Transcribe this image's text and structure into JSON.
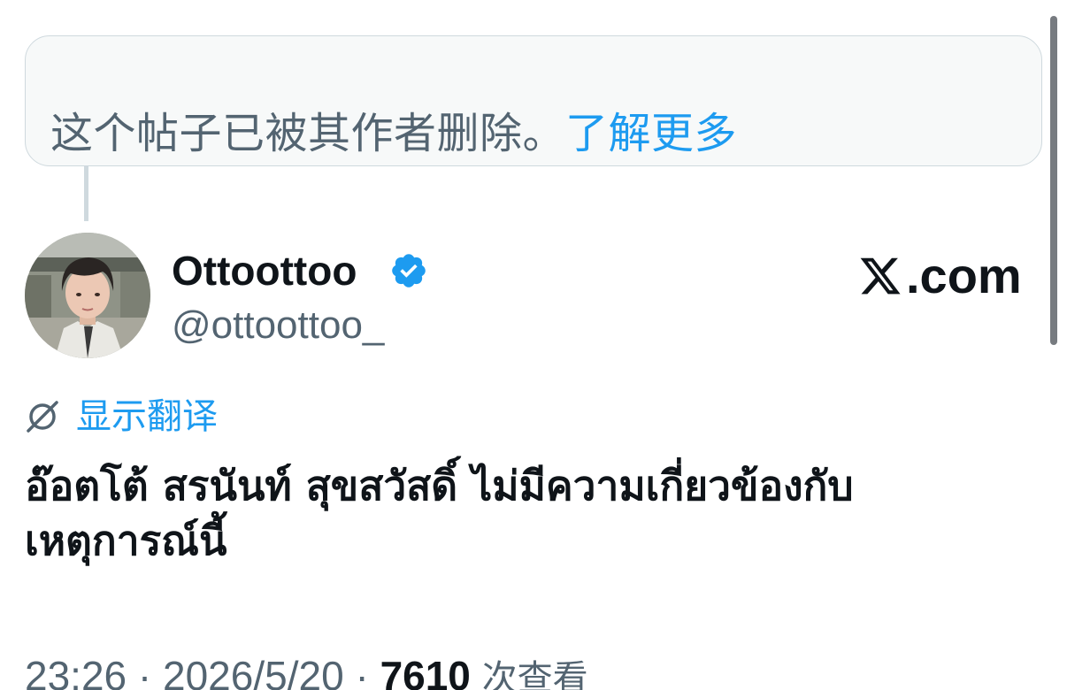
{
  "deleted_notice": {
    "text": "这个帖子已被其作者删除。",
    "link": "了解更多"
  },
  "author": {
    "display_name": "Ottoottoo",
    "handle": "@ottoottoo_",
    "verified": true,
    "avatar": "avatar"
  },
  "source": {
    "label": ".com",
    "logo": "x-logo"
  },
  "translate": {
    "icon": "globe-slash-icon",
    "label": "显示翻译"
  },
  "post": {
    "text": "อ๊อตโต้ สรนันท์ สุขสวัสดิ์ ไม่มีความเกี่ยวข้องกับเหตุการณ์นี้"
  },
  "meta": {
    "time": "23:26",
    "separator": "·",
    "date": "2026/5/20",
    "views_count": "7610",
    "views_label": "次查看"
  },
  "colors": {
    "accent": "#1d9bf0",
    "secondary_text": "#536471",
    "primary_text": "#0f1419"
  }
}
